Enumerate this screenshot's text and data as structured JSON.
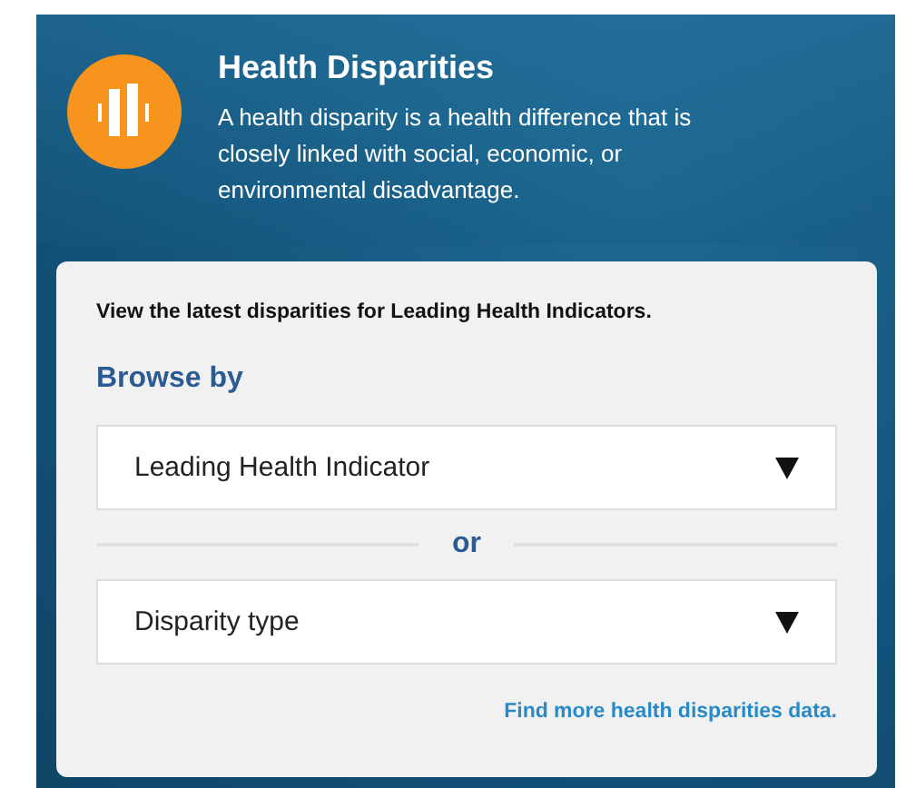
{
  "header": {
    "title": "Health Disparities",
    "description": "A health disparity is a health difference that is closely linked with social, economic, or environmental disadvantage."
  },
  "card": {
    "intro": "View the latest disparities for Leading Health Indicators.",
    "heading": "Browse by",
    "dropdowns": [
      {
        "value": "Leading Health Indicator"
      },
      {
        "value": "Disparity type"
      }
    ],
    "separator": "or",
    "link": "Find more health disparities data."
  }
}
